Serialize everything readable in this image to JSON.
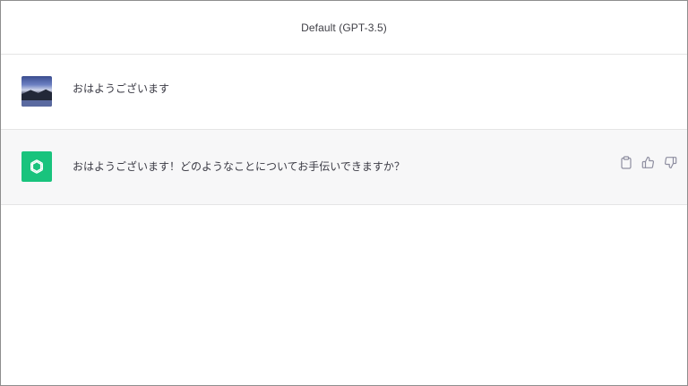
{
  "header": {
    "model_label": "Default (GPT-3.5)"
  },
  "messages": [
    {
      "role": "user",
      "avatar": "user-photo-avatar",
      "text": "おはようございます"
    },
    {
      "role": "assistant",
      "avatar": "openai-logo-icon",
      "text": "おはようございます！どのようなことについてお手伝いできますか？",
      "actions": [
        "clipboard-icon",
        "thumbs-up-icon",
        "thumbs-down-icon"
      ]
    }
  ],
  "colors": {
    "assistant_avatar_bg": "#19c37d",
    "assistant_row_bg": "#f7f7f8",
    "border": "#e5e5e5",
    "text": "#3a3a44"
  }
}
